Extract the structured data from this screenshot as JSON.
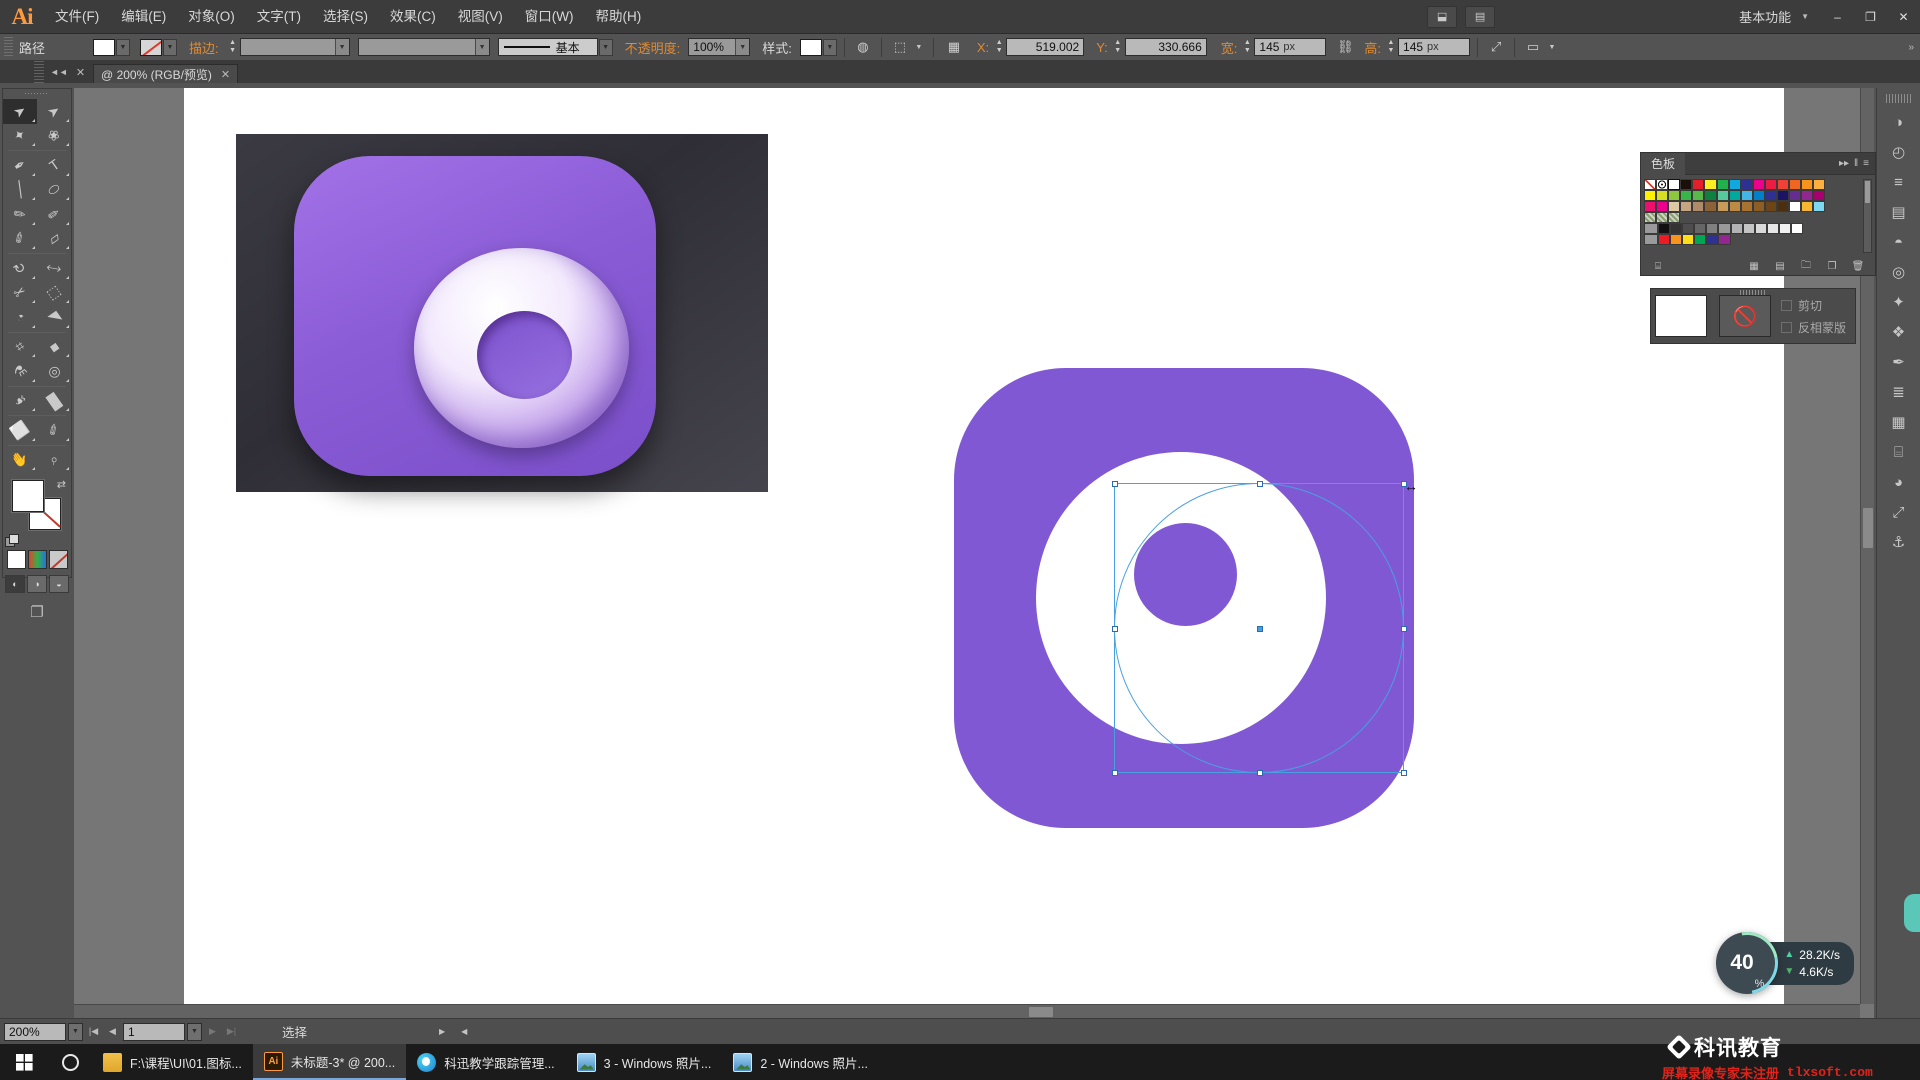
{
  "app": {
    "name": "Adobe Illustrator",
    "logo": "Ai",
    "workspace": "基本功能"
  },
  "menubar": {
    "items": [
      {
        "label": "文件(F)",
        "name": "menu-file"
      },
      {
        "label": "编辑(E)",
        "name": "menu-edit"
      },
      {
        "label": "对象(O)",
        "name": "menu-object"
      },
      {
        "label": "文字(T)",
        "name": "menu-type"
      },
      {
        "label": "选择(S)",
        "name": "menu-select"
      },
      {
        "label": "效果(C)",
        "name": "menu-effect"
      },
      {
        "label": "视图(V)",
        "name": "menu-view"
      },
      {
        "label": "窗口(W)",
        "name": "menu-window"
      },
      {
        "label": "帮助(H)",
        "name": "menu-help"
      }
    ],
    "bridge_icon": "br-icon",
    "arrange_icon": "arrange-documents-icon",
    "minimize": "–",
    "maximize": "❐",
    "close": "✕"
  },
  "optionsbar": {
    "object_label": "路径",
    "fill_swatch": "#ffffff",
    "stroke_swatch": "none",
    "stroke_label": "描边:",
    "stroke_weight": "",
    "stroke_profile": "",
    "brush_label": "基本",
    "opacity_label": "不透明度:",
    "opacity_value": "100%",
    "style_label": "样式:",
    "style_swatch": "#ffffff",
    "recolor_icon": "recolor-artwork-icon",
    "align_icon": "align-icon",
    "transform_icon": "transform-reference-icon",
    "x_label": "X:",
    "x_value": "519.002",
    "y_label": "Y:",
    "y_value": "330.666",
    "w_label": "宽:",
    "w_value": "145",
    "w_unit": "px",
    "link_icon": "constrain-proportions-icon",
    "h_label": "高:",
    "h_value": "145",
    "h_unit": "px",
    "transform_panel_icon": "transform-icon",
    "more_icon": "more-options-icon"
  },
  "doctab": {
    "title": "@ 200% (RGB/预览)",
    "close": "✕",
    "collapse": "◄◄",
    "panel_close": "✕"
  },
  "toolbar": {
    "tools": [
      {
        "name": "selection-tool",
        "glyph": "➤",
        "selected": true
      },
      {
        "name": "direct-selection-tool",
        "glyph": "➤",
        "selected": false
      },
      {
        "name": "magic-wand-tool",
        "glyph": "✦",
        "selected": false
      },
      {
        "name": "lasso-tool",
        "glyph": "❀",
        "selected": false
      },
      {
        "name": "pen-tool",
        "glyph": "✒",
        "selected": false
      },
      {
        "name": "type-tool",
        "glyph": "T",
        "selected": false
      },
      {
        "name": "line-segment-tool",
        "glyph": "╱",
        "selected": false
      },
      {
        "name": "ellipse-tool",
        "glyph": "⬭",
        "selected": false
      },
      {
        "name": "paintbrush-tool",
        "glyph": "✎",
        "selected": false
      },
      {
        "name": "pencil-tool",
        "glyph": "✏",
        "selected": false
      },
      {
        "name": "blob-brush-tool",
        "glyph": "✐",
        "selected": false
      },
      {
        "name": "eraser-tool",
        "glyph": "▱",
        "selected": false
      },
      {
        "name": "rotate-tool",
        "glyph": "↻",
        "selected": false
      },
      {
        "name": "scale-tool",
        "glyph": "⤡",
        "selected": false
      },
      {
        "name": "width-tool",
        "glyph": "✂",
        "selected": false
      },
      {
        "name": "free-transform-tool",
        "glyph": "⬚",
        "selected": false
      },
      {
        "name": "shape-builder-tool",
        "glyph": "◔",
        "selected": false
      },
      {
        "name": "perspective-grid-tool",
        "glyph": "◥",
        "selected": false
      },
      {
        "name": "mesh-tool",
        "glyph": "⌗",
        "selected": false
      },
      {
        "name": "gradient-tool",
        "glyph": "■",
        "selected": false
      },
      {
        "name": "eyedropper-tool",
        "glyph": "⚗",
        "selected": false
      },
      {
        "name": "blend-tool",
        "glyph": "◎",
        "selected": false
      },
      {
        "name": "symbol-sprayer-tool",
        "glyph": "☙",
        "selected": false
      },
      {
        "name": "column-graph-tool",
        "glyph": "█",
        "selected": false
      },
      {
        "name": "artboard-tool",
        "glyph": "⬜",
        "selected": false
      },
      {
        "name": "slice-tool",
        "glyph": "✐",
        "selected": false
      },
      {
        "name": "hand-tool",
        "glyph": "✋",
        "selected": false
      },
      {
        "name": "zoom-tool",
        "glyph": "⌕",
        "selected": false
      }
    ],
    "fill_color": "#ffffff",
    "stroke_color": "#ffffff",
    "swap_icon": "swap-fill-stroke-icon",
    "default_icon": "default-fill-stroke-icon",
    "color_mode": "color-mode-button",
    "gradient_mode": "gradient-mode-button",
    "none_mode": "none-mode-button",
    "draw_normal": "draw-normal-button",
    "draw_behind": "draw-behind-button",
    "draw_inside": "draw-inside-button",
    "screen_mode": "change-screen-mode-button"
  },
  "swatches_panel": {
    "title": "色板",
    "expand_icon": "expand-panel-icon",
    "menu_icon": "panel-menu-icon",
    "rows": [
      [
        "none",
        "registration",
        "#ffffff",
        "#1a1008",
        "#e3202a",
        "#fcee21",
        "#21b24b",
        "#0fa9e0",
        "#2e3192",
        "#ec008c",
        "#ed1c45",
        "#ef4136",
        "#f16522",
        "#f7941e",
        "#fbb040"
      ],
      [
        "#fff200",
        "#d7df23",
        "#8dc63f",
        "#39b54a",
        "#57b947",
        "#0e8040",
        "#57c99e",
        "#00a99d",
        "#44b6e5",
        "#0080c8",
        "#2e3192",
        "#1b1464",
        "#662d91",
        "#92278f",
        "#a8006e"
      ],
      [
        "#ec0f6e",
        "#ec008c",
        "#ddc9a3",
        "#c6a682",
        "#b08b6a",
        "#8c6239",
        "#c79b5a",
        "#bc8a44",
        "#a87331",
        "#8c5d25",
        "#6b4518",
        "#4a2f10",
        "#ffffff",
        "#f7b733",
        "#7fd7f0"
      ],
      [
        "pattern1",
        "pattern2",
        "pattern3"
      ],
      [
        "folder",
        "#111111",
        "#333333",
        "#4d4d4d",
        "#666666",
        "#808080",
        "#999999",
        "#b3b3b3",
        "#c4c4c4",
        "#d9d9d9",
        "#e6e6e6",
        "#f2f2f2",
        "#ffffff"
      ],
      [
        "folder",
        "#ed1c24",
        "#f7941e",
        "#ffde17",
        "#00a651",
        "#2e3192",
        "#92278f"
      ]
    ],
    "footer_icons": [
      "swatch-libraries-icon",
      "show-swatch-kinds-icon",
      "swatch-options-icon",
      "new-color-group-icon",
      "new-swatch-icon",
      "delete-swatch-icon"
    ],
    "scrollbar": "swatches-scrollbar"
  },
  "transparency_panel": {
    "thumbnail": "#ffffff",
    "mask_icon": "no-mask-icon",
    "clip_label": "剪切",
    "invert_label": "反相蒙版"
  },
  "right_dock": {
    "buttons": [
      {
        "name": "dock-color-icon",
        "glyph": "◑"
      },
      {
        "name": "dock-color-guide-icon",
        "glyph": "◴"
      },
      {
        "name": "dock-stroke-icon",
        "glyph": "≡"
      },
      {
        "name": "dock-gradient-icon",
        "glyph": "▤"
      },
      {
        "name": "dock-transparency-icon",
        "glyph": "◓"
      },
      {
        "name": "dock-appearance-icon",
        "glyph": "◎"
      },
      {
        "name": "dock-graphic-styles-icon",
        "glyph": "✦"
      },
      {
        "name": "dock-symbols-icon",
        "glyph": "❖"
      },
      {
        "name": "dock-brushes-icon",
        "glyph": "✒"
      },
      {
        "name": "dock-layers-icon",
        "glyph": "≣"
      },
      {
        "name": "dock-artboards-icon",
        "glyph": "▦"
      },
      {
        "name": "dock-align-icon",
        "glyph": "⌸"
      },
      {
        "name": "dock-pathfinder-icon",
        "glyph": "◕"
      },
      {
        "name": "dock-transform-icon",
        "glyph": "⤢"
      },
      {
        "name": "dock-links-icon",
        "glyph": "⚓"
      }
    ]
  },
  "canvas": {
    "photo": {
      "name": "reference-image",
      "alt": "purple app icon reference"
    },
    "vector": {
      "name": "vector-artwork",
      "square_color": "#8158d4",
      "circle_color": "#ffffff",
      "dot_color": "#8158d4"
    },
    "selection": {
      "name": "selection-bounding-box",
      "color": "#49a0e0"
    },
    "cursor": "move-cursor"
  },
  "statusbar": {
    "zoom": "200%",
    "page": "1",
    "status_text": "选择",
    "first_icon": "first-page-icon",
    "prev_icon": "previous-page-icon",
    "next_icon": "next-page-icon",
    "last_icon": "last-page-icon",
    "expand_icon": "status-expand-icon",
    "collapse_icon": "status-collapse-icon"
  },
  "network_widget": {
    "percent": "40",
    "percent_unit": "%",
    "upload": "28.2K/s",
    "download": "4.6K/s",
    "up_icon": "arrow-up-icon",
    "down_icon": "arrow-down-icon"
  },
  "taskbar": {
    "start": "start-button",
    "cortana": "cortana-search-button",
    "apps": [
      {
        "name": "taskbar-explorer",
        "label": "F:\\课程\\UI\\01.图标...",
        "icon": "folder-icon",
        "active": false
      },
      {
        "name": "taskbar-illustrator",
        "label": "未标题-3* @ 200...",
        "icon": "ai-icon",
        "active": true
      },
      {
        "name": "taskbar-kexun",
        "label": "科迅教学跟踪管理...",
        "icon": "app-ball-icon",
        "active": false
      },
      {
        "name": "taskbar-photos-3",
        "label": "3 - Windows 照片...",
        "icon": "photos-icon",
        "active": false
      },
      {
        "name": "taskbar-photos-2",
        "label": "2 - Windows 照片...",
        "icon": "photos-icon",
        "active": false
      }
    ]
  },
  "watermark": {
    "brand": "科讯教育",
    "notice": "屏幕录像专家未注册",
    "url": "tlxsoft.com"
  }
}
